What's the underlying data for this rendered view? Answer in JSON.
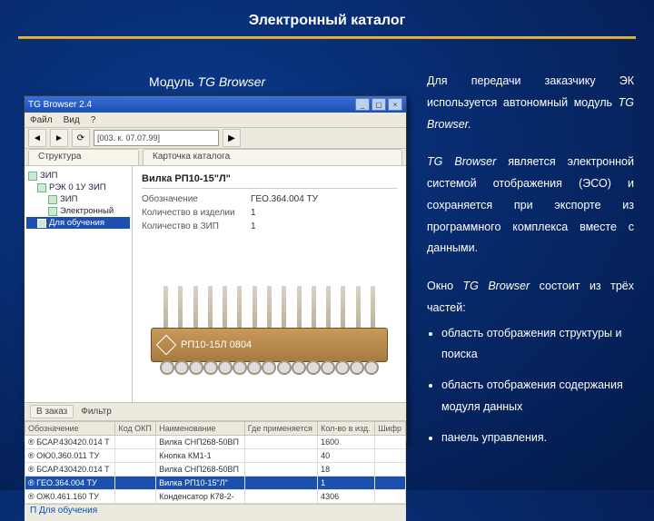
{
  "title": "Электронный каталог",
  "caption_prefix": "Модуль ",
  "caption_em": "TG Browser",
  "right": {
    "p1a": "Для передачи заказчику ЭК используется автономный модуль ",
    "p1em": "TG Browser.",
    "p2em": "TG Browser",
    "p2b": " является электронной системой отображения (ЭСО) и сохраняется при экспорте из программного комплекса вместе с данными.",
    "p3a": "Окно ",
    "p3em": "TG Browser",
    "p3b": " состоит из трёх частей:",
    "b1": "область отображения структуры и поиска",
    "b2": "область отображения содержания модуля данных",
    "b3": "панель управления."
  },
  "shot": {
    "title": "TG Browser 2.4",
    "addr": "[003. к. 07.07.99]",
    "menu": [
      "Файл",
      "Вид",
      "?"
    ],
    "tab_left": "Структура",
    "tab_right": "Карточка каталога",
    "tree": {
      "n0": "ЗИП",
      "n1": "РЭК 0 1У ЗИП",
      "n2": "ЗИП",
      "n3": "Электронный",
      "n4": "Для обучения"
    },
    "card": {
      "title": "Вилка РП10-15\"Л\"",
      "rows": [
        {
          "k": "Обозначение",
          "v": "ГЕО.364.004 ТУ"
        },
        {
          "k": "Количество в изделии",
          "v": "1"
        },
        {
          "k": "Количество в ЗИП",
          "v": "1"
        }
      ],
      "conn_label": "РП10-15Л 0804"
    },
    "table": {
      "toolbar": {
        "btn": "В заказ",
        "lbl": "Фильтр"
      },
      "cols": [
        "Обозначение",
        "Код ОКП",
        "Наименование",
        "Где применяется",
        "Кол-во в изд.",
        "Шифр"
      ],
      "rows": [
        [
          "® БСАР.430420.014 Т",
          "",
          "Вилка СНП268-50ВП",
          "",
          "1600",
          ""
        ],
        [
          "® ОЮ0.360.011 ТУ",
          "",
          "Кнопка КМ1-1",
          "",
          "40",
          ""
        ],
        [
          "® БСАР.430420.014 Т",
          "",
          "Вилка СНП268-50ВП",
          "",
          "18",
          ""
        ],
        [
          "® ГЕО.364.004 ТУ",
          "",
          "Вилка РП10-15\"Л\"",
          "",
          "1",
          ""
        ],
        [
          "® ОЖ0.461.160 ТУ",
          "",
          "Конденсатор К78-2-",
          "",
          "4306",
          ""
        ]
      ],
      "hl_index": 3
    },
    "status": "П Для обучения"
  }
}
